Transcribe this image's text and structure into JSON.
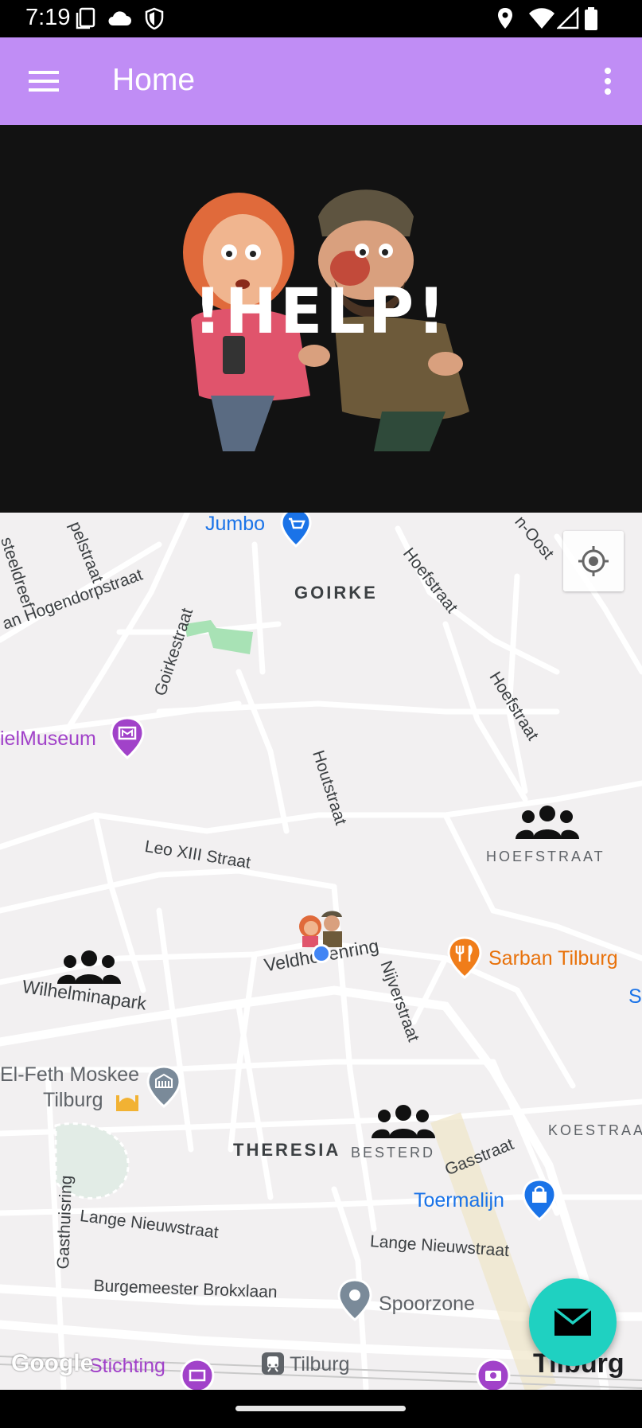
{
  "status_bar": {
    "time": "7:19",
    "icons": [
      "screenshot-icon",
      "cloud-icon",
      "shield-icon",
      "location-icon",
      "wifi-icon",
      "signal-icon",
      "battery-icon"
    ]
  },
  "app_bar": {
    "title": "Home",
    "menu_icon": "hamburger-menu-icon",
    "overflow_icon": "more-vert-icon",
    "color": "#c08df5"
  },
  "banner": {
    "title": "!HELP!"
  },
  "map": {
    "districts": [
      "GOIRKE",
      "HOEFSTRAAT",
      "THERESIA",
      "BESTERD",
      "KOESTRAAT"
    ],
    "streets": [
      "steeldreef",
      "pelstraat",
      "an Hogendorpstraat",
      "Goirkestraat",
      "Hoefstraat",
      "Hoefstraat",
      "Houtstraat",
      "Leo XIII Straat",
      "Veldhovenring",
      "Nijverstraat",
      "Wilhelminapark",
      "Gasstraat",
      "Gasthuisring",
      "Lange Nieuwstraat",
      "Lange Nieuwstraat",
      "Burgemeester Brokxlaan",
      "n-Oost"
    ],
    "pois": {
      "jumbo": "Jumbo",
      "museum": "ielMuseum",
      "restaurant": "Sarban Tilburg",
      "mosque_line1": "El-Feth Moskee",
      "mosque_line2": "Tilburg",
      "shop": "Toermalijn",
      "spoorzone": "Spoorzone",
      "station": "Tilburg",
      "stichting": "Stichting",
      "city": "Tilburg",
      "edge_label": "Sl"
    },
    "attribution": "Google",
    "my_location_icon": "my-location-icon",
    "group_icon": "people-group-icon"
  },
  "fab": {
    "icon": "mail-icon",
    "color": "#1fd1c1"
  }
}
